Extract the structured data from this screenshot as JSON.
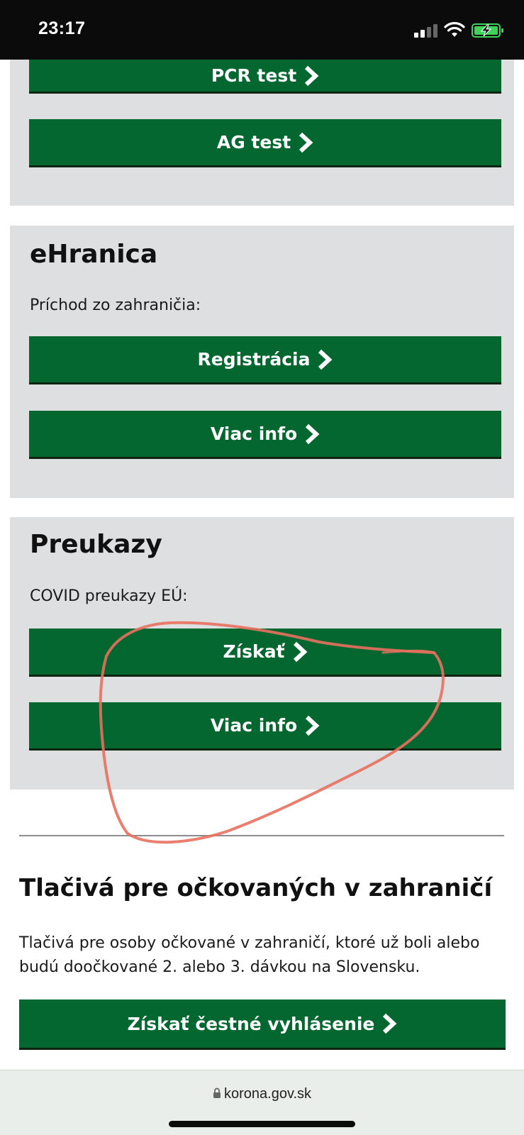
{
  "status_bar": {
    "time": "23:17"
  },
  "test_section": {
    "buttons": [
      {
        "label": "PCR test"
      },
      {
        "label": "AG test"
      }
    ]
  },
  "ehranica": {
    "title": "eHranica",
    "subtitle": "Príchod zo zahraničia:",
    "buttons": [
      {
        "label": "Registrácia"
      },
      {
        "label": "Viac info"
      }
    ]
  },
  "preukazy": {
    "title": "Preukazy",
    "subtitle": "COVID preukazy EÚ:",
    "buttons": [
      {
        "label": "Získať"
      },
      {
        "label": "Viac info"
      }
    ]
  },
  "tlaciva": {
    "title": "Tlačivá pre očkovaných v zahraničí",
    "description": "Tlačivá pre osoby očkované v zahraničí, ktoré už boli alebo budú doočkované 2. alebo 3. dávkou na Slovensku.",
    "button_label": "Získať čestné vyhlásenie"
  },
  "browser": {
    "url": "korona.gov.sk"
  },
  "colors": {
    "button_green": "#04672f",
    "card_gray": "#dedfe1",
    "annotation_red": "#e8705f"
  },
  "icons": [
    "chevron-right-icon",
    "lock-icon",
    "signal-icon",
    "wifi-icon",
    "battery-charging-icon"
  ]
}
